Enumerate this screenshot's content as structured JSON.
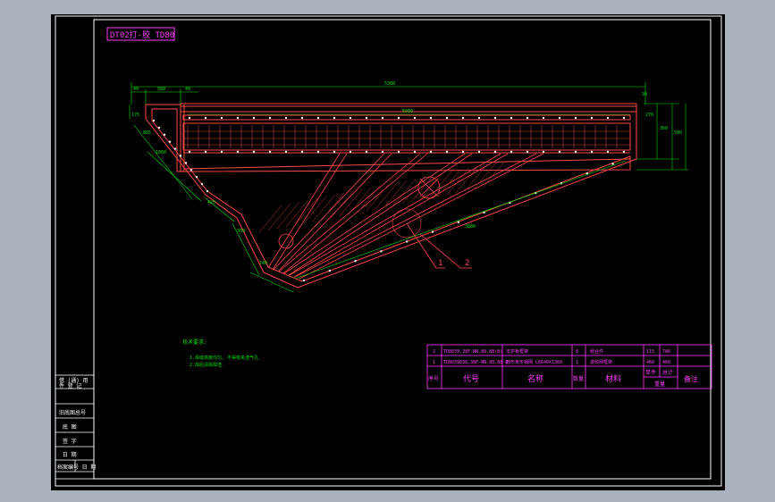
{
  "title_block_label": "DT02打-胶 TD80",
  "dims": {
    "overall_length": "5300",
    "inner_length": "5000",
    "diagonal_length": "3800",
    "left_a": "40",
    "left_b": "580",
    "left_c": "40",
    "right_a": "30",
    "right_b": "270",
    "right_c": "360",
    "right_d": "590",
    "left_h": "175",
    "slope1": "865",
    "slope2": "1060",
    "slope3": "420",
    "bottom_a": "300",
    "bottom_b": "240"
  },
  "balloons": [
    "1",
    "2"
  ],
  "tech_notes": {
    "title": "技术要求:",
    "line1": "1.焊缝高度均匀, 不得有夹渣气孔.",
    "line2": "2.焊后清除焊渣."
  },
  "parts_table": {
    "rows": [
      {
        "no": "2",
        "code": "TD8039.38F-NN.88.88(8)",
        "name": "支护板框架",
        "qty": "8",
        "material": "组合件",
        "w1": "115",
        "w2": "786"
      },
      {
        "no": "1",
        "code": "TD8039038.38F-NN.88.88-8",
        "name": "鼓形条形钢网 L6640X1360",
        "qty": "1",
        "material": "波纹网框架",
        "w1": "460",
        "w2": "460"
      }
    ],
    "header": {
      "no": "序号",
      "code": "代号",
      "name": "名称",
      "qty": "数量",
      "material": "材料",
      "single": "单件",
      "total": "总计",
      "weight": "重量",
      "remark": "备注"
    }
  },
  "side_stamp": {
    "r1": "借 (通) 用",
    "r2": "件 登 记",
    "r3": "旧底图总号",
    "r4": "底 图",
    "r5": "签 字",
    "r6": "日 期",
    "r7": "档案编号  日 期"
  }
}
